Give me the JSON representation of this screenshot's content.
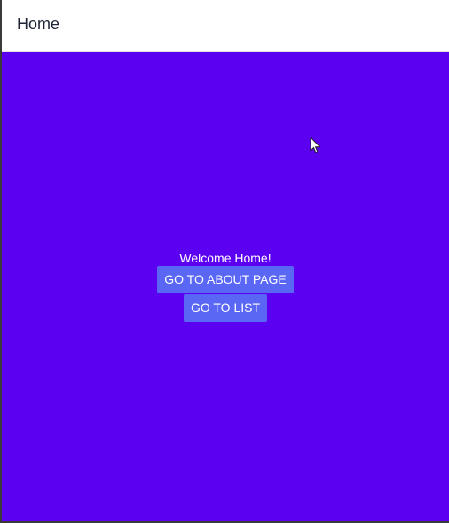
{
  "header": {
    "title": "Home"
  },
  "main": {
    "welcome_text": "Welcome Home!",
    "about_button_label": "GO TO ABOUT PAGE",
    "list_button_label": "GO TO LIST"
  },
  "colors": {
    "content_background": "#5c00f2",
    "button_background": "#5a67f5",
    "header_background": "#ffffff"
  },
  "icons": {
    "cursor": "mouse-pointer-icon"
  }
}
